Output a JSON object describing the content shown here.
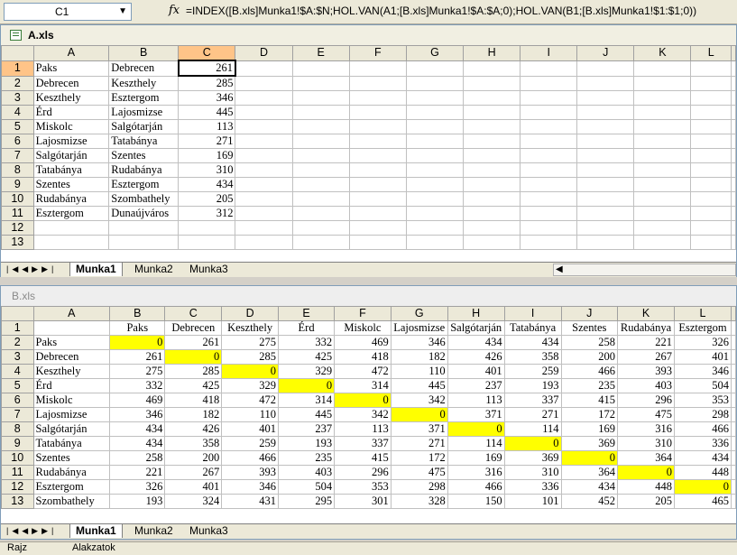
{
  "formula_bar": {
    "name_box": "C1",
    "fx_label": "fx",
    "formula": "=INDEX([B.xls]Munka1!$A:$N;HOL.VAN(A1;[B.xls]Munka1!$A:$A;0);HOL.VAN(B1;[B.xls]Munka1!$1:$1;0))"
  },
  "workbook_a": {
    "title": "A.xls",
    "columns": [
      "A",
      "B",
      "C",
      "D",
      "E",
      "F",
      "G",
      "H",
      "I",
      "J",
      "K",
      "L"
    ],
    "rows": [
      {
        "n": "1",
        "a": "Paks",
        "b": "Debrecen",
        "c": "261"
      },
      {
        "n": "2",
        "a": "Debrecen",
        "b": "Keszthely",
        "c": "285"
      },
      {
        "n": "3",
        "a": "Keszthely",
        "b": "Esztergom",
        "c": "346"
      },
      {
        "n": "4",
        "a": "Érd",
        "b": "Lajosmizse",
        "c": "445"
      },
      {
        "n": "5",
        "a": "Miskolc",
        "b": "Salgótarján",
        "c": "113"
      },
      {
        "n": "6",
        "a": "Lajosmizse",
        "b": "Tatabánya",
        "c": "271"
      },
      {
        "n": "7",
        "a": "Salgótarján",
        "b": "Szentes",
        "c": "169"
      },
      {
        "n": "8",
        "a": "Tatabánya",
        "b": "Rudabánya",
        "c": "310"
      },
      {
        "n": "9",
        "a": "Szentes",
        "b": "Esztergom",
        "c": "434"
      },
      {
        "n": "10",
        "a": "Rudabánya",
        "b": "Szombathely",
        "c": "205"
      },
      {
        "n": "11",
        "a": "Esztergom",
        "b": "Dunaújváros",
        "c": "312"
      },
      {
        "n": "12",
        "a": "",
        "b": "",
        "c": ""
      },
      {
        "n": "13",
        "a": "",
        "b": "",
        "c": ""
      }
    ],
    "tabs": [
      "Munka1",
      "Munka2",
      "Munka3"
    ]
  },
  "workbook_b": {
    "title": "B.xls",
    "columns": [
      "A",
      "B",
      "C",
      "D",
      "E",
      "F",
      "G",
      "H",
      "I",
      "J",
      "K",
      "L"
    ],
    "header_row": {
      "n": "1",
      "cells": [
        "",
        "Paks",
        "Debrecen",
        "Keszthely",
        "Érd",
        "Miskolc",
        "Lajosmizse",
        "Salgótarján",
        "Tatabánya",
        "Szentes",
        "Rudabánya",
        "Esztergom"
      ]
    },
    "rows": [
      {
        "n": "2",
        "name": "Paks",
        "vals": [
          "0",
          "261",
          "275",
          "332",
          "469",
          "346",
          "434",
          "434",
          "258",
          "221",
          "326"
        ]
      },
      {
        "n": "3",
        "name": "Debrecen",
        "vals": [
          "261",
          "0",
          "285",
          "425",
          "418",
          "182",
          "426",
          "358",
          "200",
          "267",
          "401"
        ]
      },
      {
        "n": "4",
        "name": "Keszthely",
        "vals": [
          "275",
          "285",
          "0",
          "329",
          "472",
          "110",
          "401",
          "259",
          "466",
          "393",
          "346"
        ]
      },
      {
        "n": "5",
        "name": "Érd",
        "vals": [
          "332",
          "425",
          "329",
          "0",
          "314",
          "445",
          "237",
          "193",
          "235",
          "403",
          "504"
        ]
      },
      {
        "n": "6",
        "name": "Miskolc",
        "vals": [
          "469",
          "418",
          "472",
          "314",
          "0",
          "342",
          "113",
          "337",
          "415",
          "296",
          "353"
        ]
      },
      {
        "n": "7",
        "name": "Lajosmizse",
        "vals": [
          "346",
          "182",
          "110",
          "445",
          "342",
          "0",
          "371",
          "271",
          "172",
          "475",
          "298"
        ]
      },
      {
        "n": "8",
        "name": "Salgótarján",
        "vals": [
          "434",
          "426",
          "401",
          "237",
          "113",
          "371",
          "0",
          "114",
          "169",
          "316",
          "466"
        ]
      },
      {
        "n": "9",
        "name": "Tatabánya",
        "vals": [
          "434",
          "358",
          "259",
          "193",
          "337",
          "271",
          "114",
          "0",
          "369",
          "310",
          "336"
        ]
      },
      {
        "n": "10",
        "name": "Szentes",
        "vals": [
          "258",
          "200",
          "466",
          "235",
          "415",
          "172",
          "169",
          "369",
          "0",
          "364",
          "434"
        ]
      },
      {
        "n": "11",
        "name": "Rudabánya",
        "vals": [
          "221",
          "267",
          "393",
          "403",
          "296",
          "475",
          "316",
          "310",
          "364",
          "0",
          "448"
        ]
      },
      {
        "n": "12",
        "name": "Esztergom",
        "vals": [
          "326",
          "401",
          "346",
          "504",
          "353",
          "298",
          "466",
          "336",
          "434",
          "448",
          "0"
        ]
      },
      {
        "n": "13",
        "name": "Szombathely",
        "vals": [
          "193",
          "324",
          "431",
          "295",
          "301",
          "328",
          "150",
          "101",
          "452",
          "205",
          "465"
        ]
      }
    ],
    "tabs": [
      "Munka1",
      "Munka2",
      "Munka3"
    ]
  },
  "status_bar": {
    "draw_label": "Rajz",
    "autoshapes_label": "Alakzatok"
  },
  "colors": {
    "highlight_yellow": "#ffff00",
    "selected_header": "#ffc488"
  }
}
